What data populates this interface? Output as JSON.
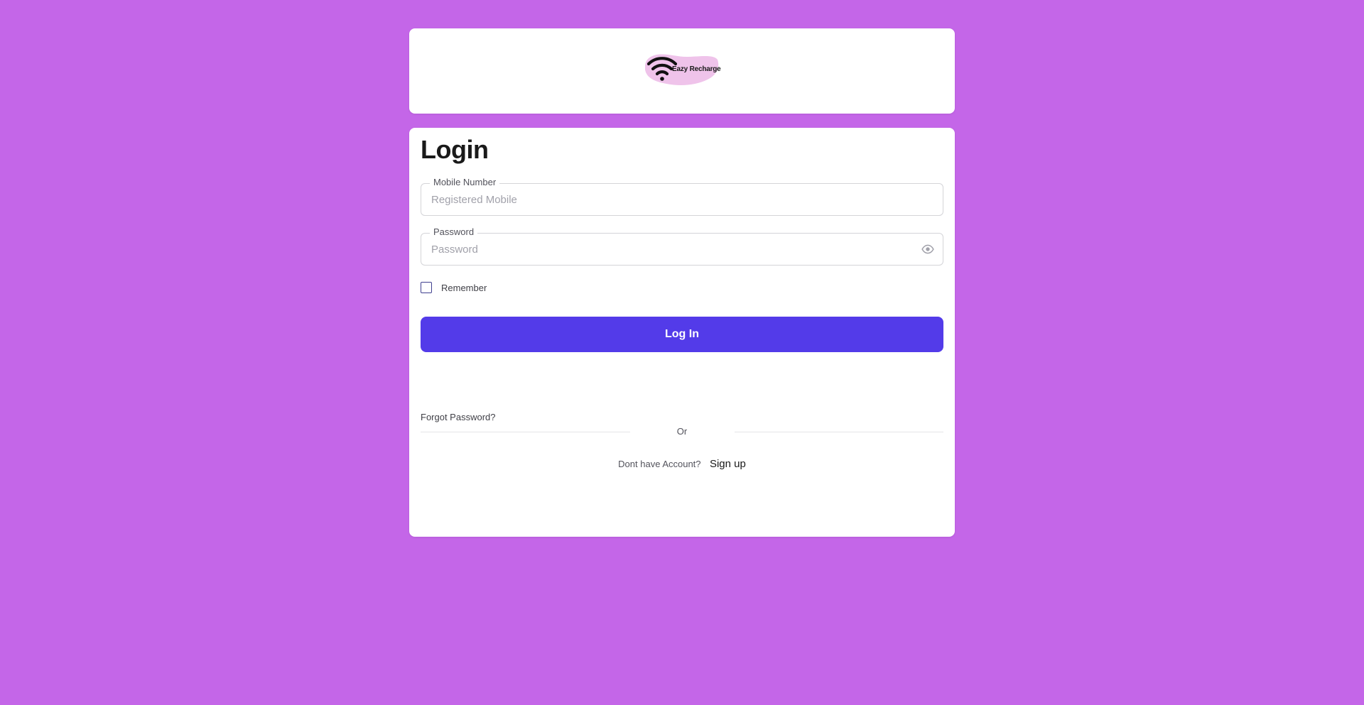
{
  "header": {
    "logo": {
      "icon": "wifi-icon",
      "text": "Eazy Recharge",
      "blob_color": "#efc3ea"
    }
  },
  "login": {
    "title": "Login",
    "mobile": {
      "label": "Mobile Number",
      "placeholder": "Registered Mobile",
      "value": ""
    },
    "password": {
      "label": "Password",
      "placeholder": "Password",
      "value": "",
      "toggle_icon": "eye-icon"
    },
    "remember": {
      "label": "Remember",
      "checked": false
    },
    "submit_label": "Log In",
    "forgot_label": "Forgot Password?",
    "divider_label": "Or",
    "signup_prompt": "Dont have Account?",
    "signup_label": "Sign up"
  },
  "colors": {
    "page_background": "#c466e8",
    "card_background": "#ffffff",
    "primary_button": "#533be9",
    "checkbox_border": "#3f3f8f"
  }
}
